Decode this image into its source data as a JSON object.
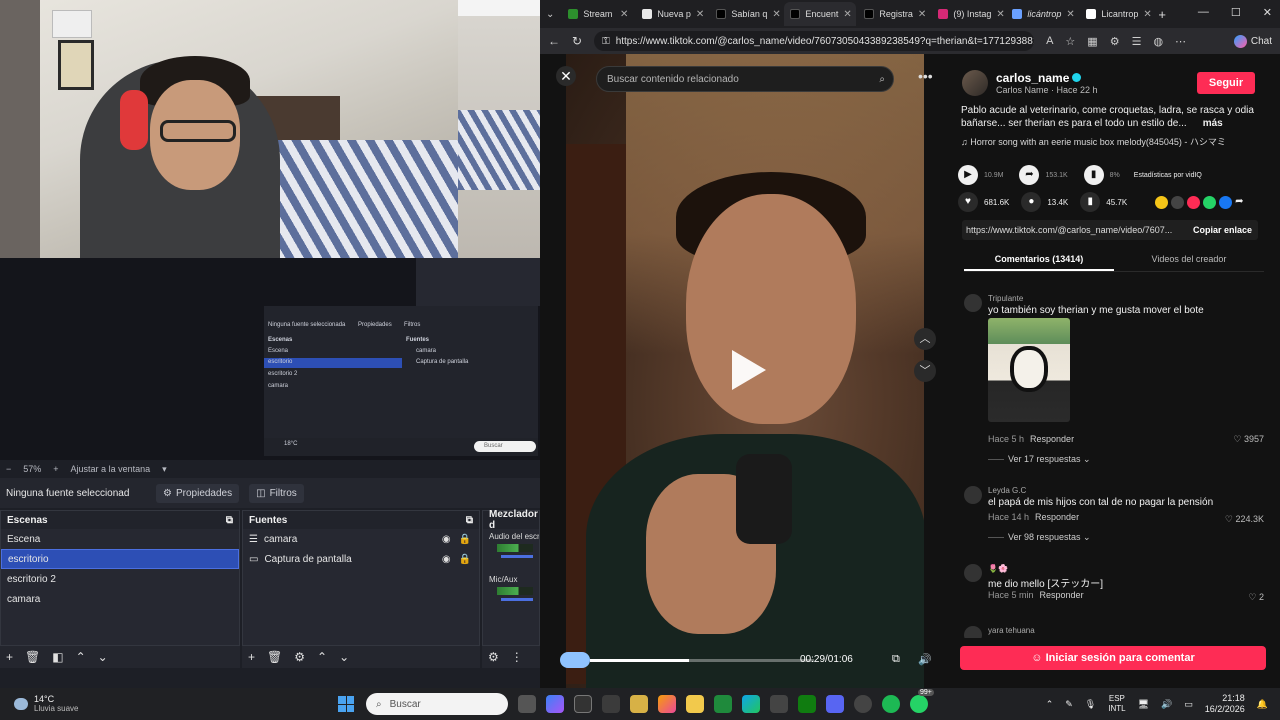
{
  "obs": {
    "zoom": "57%",
    "fit_window": "Ajustar a la ventana",
    "no_source": "Ninguna fuente seleccionad",
    "properties_btn": "Propiedades",
    "filters_btn": "Filtros",
    "scenes_title": "Escenas",
    "scenes": [
      "Escena",
      "escritorio",
      "escritorio 2",
      "camara"
    ],
    "selected_scene_index": 1,
    "sources_title": "Fuentes",
    "sources": [
      "camara",
      "Captura de pantalla"
    ],
    "mixer_title": "Mezclador d",
    "mixer_channels": [
      "Audio del escr",
      "Mic/Aux"
    ],
    "nested": {
      "no_source": "Ninguna fuente seleccionada",
      "properties": "Propiedades",
      "filters": "Filtros",
      "scenes_title": "Escenas",
      "sources_title": "Fuentes",
      "scenes": [
        "Escena",
        "escritorio",
        "escritorio 2",
        "camara"
      ],
      "sources": [
        "camara",
        "Captura de pantalla"
      ],
      "search": "Buscar",
      "weather": "18°C"
    }
  },
  "browser": {
    "tabs": [
      {
        "label": "Stream",
        "color": "#2d8f2d"
      },
      {
        "label": "Nueva p",
        "color": "#e8e8e8"
      },
      {
        "label": "Sabían q",
        "color": "#111111"
      },
      {
        "label": "Encuent",
        "color": "#111111"
      },
      {
        "label": "Registra",
        "color": "#111111"
      },
      {
        "label": "(9) Instag",
        "color": "#d62976"
      },
      {
        "label": "licántrop",
        "color": "#6aa0ff"
      },
      {
        "label": "Licantrop",
        "color": "#ffffff"
      }
    ],
    "active_tab_index": 3,
    "url": "https://www.tiktok.com/@carlos_name/video/7607305043389238549?q=therian&t=1771293881...",
    "copilot_label": "Chat"
  },
  "tiktok": {
    "search_placeholder": "Buscar contenido relacionado",
    "video_time": "00:29/01:06",
    "video_progress": 0.44,
    "author_handle": "carlos_name",
    "author_sub": "Carlos Name · Hace 22 h",
    "follow": "Seguir",
    "description": "Pablo acude al veterinario, come croquetas, ladra, se rasca y odia bañarse... ser therian es para el todo un estilo de...",
    "more": "más",
    "music": "♫  Horror song with an eerie music box melody(845045) - ハシマミ",
    "stats_label": "Estadísticas por vidIQ",
    "stat_views": "10.9M",
    "stat_shares": "153.1K",
    "stat_pct": "8%",
    "likes": "681.6K",
    "comments_count": "13.4K",
    "saves": "45.7K",
    "link": "https://www.tiktok.com/@carlos_name/video/7607...",
    "copy_link": "Copiar enlace",
    "tab_comments": "Comentarios (13414)",
    "tab_creator": "Videos del creador",
    "comments": [
      {
        "user": "Tripulante",
        "text": "yo también soy therian y me gusta mover el bote",
        "time": "Hace 5 h",
        "reply": "Responder",
        "likes": "3957",
        "replies": "Ver 17 respuestas"
      },
      {
        "user": "Leyda G.C",
        "text": "el papá de mis hijos con tal de no pagar la pensión",
        "time": "Hace 14 h",
        "reply": "Responder",
        "likes": "224.3K",
        "replies": "Ver 98 respuestas"
      },
      {
        "user": "🌷🌸",
        "text": "me dio mello [ステッカー]",
        "time": "Hace 5 min",
        "reply": "Responder",
        "likes": "2"
      },
      {
        "user": "yara tehuana",
        "text": ""
      }
    ],
    "login": "Iniciar sesión para comentar"
  },
  "taskbar": {
    "temp": "14°C",
    "condition": "Lluvia suave",
    "search": "Buscar",
    "lang": "ESP",
    "layout": "INTL",
    "time": "21:18",
    "date": "16/2/2026",
    "badge": "99+"
  }
}
